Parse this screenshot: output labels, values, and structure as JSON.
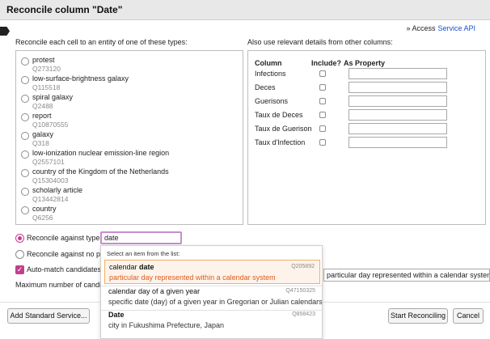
{
  "dialog": {
    "title": "Reconcile column \"Date\"",
    "access_prefix": "» Access",
    "access_link": "Service API"
  },
  "types_panel": {
    "heading": "Reconcile each cell to an entity of one of these types:",
    "items": [
      {
        "name": "protest",
        "id": "Q273120"
      },
      {
        "name": "low-surface-brightness galaxy",
        "id": "Q115518"
      },
      {
        "name": "spiral galaxy",
        "id": "Q2488"
      },
      {
        "name": "report",
        "id": "Q10870555"
      },
      {
        "name": "galaxy",
        "id": "Q318"
      },
      {
        "name": "low-ionization nuclear emission-line region",
        "id": "Q2557101"
      },
      {
        "name": "country of the Kingdom of the Netherlands",
        "id": "Q15304003"
      },
      {
        "name": "scholarly article",
        "id": "Q13442814"
      },
      {
        "name": "country",
        "id": "Q6256"
      }
    ]
  },
  "columns_panel": {
    "heading": "Also use relevant details from other columns:",
    "col_header": "Column",
    "include_header": "Include?",
    "property_header": "As Property",
    "rows": [
      {
        "name": "Infections"
      },
      {
        "name": "Deces"
      },
      {
        "name": "Guerisons"
      },
      {
        "name": "Taux de Deces"
      },
      {
        "name": "Taux de Guerison"
      },
      {
        "name": "Taux d'Infection"
      }
    ]
  },
  "options": {
    "against_type_label": "Reconcile against type:",
    "type_value": "date",
    "no_particular_label": "Reconcile against no pa",
    "auto_match_label": "Auto-match candidates v",
    "max_candidates_label": "Maximum number of candid",
    "property_value": "particular day represented within a calendar system"
  },
  "dropdown": {
    "hint": "Select an item from the list:",
    "items": [
      {
        "name_plain": "calendar",
        "name_bold": "date",
        "id": "Q205892",
        "desc": "particular day represented within a calendar system"
      },
      {
        "name_plain": "calendar day of a given year",
        "name_bold": "",
        "id": "Q47150325",
        "desc": "specific date (day) of a given year in Gregorian or Julian calendars"
      },
      {
        "name_plain": "",
        "name_bold": "Date",
        "id": "Q858423",
        "desc": "city in Fukushima Prefecture, Japan"
      }
    ]
  },
  "footer": {
    "add_service": "Add Standard Service...",
    "start": "Start Reconciling",
    "cancel": "Cancel"
  },
  "colors": {
    "accent": "#c1408b",
    "link": "#1a4fd8",
    "highlight_text": "#e05a1a"
  }
}
